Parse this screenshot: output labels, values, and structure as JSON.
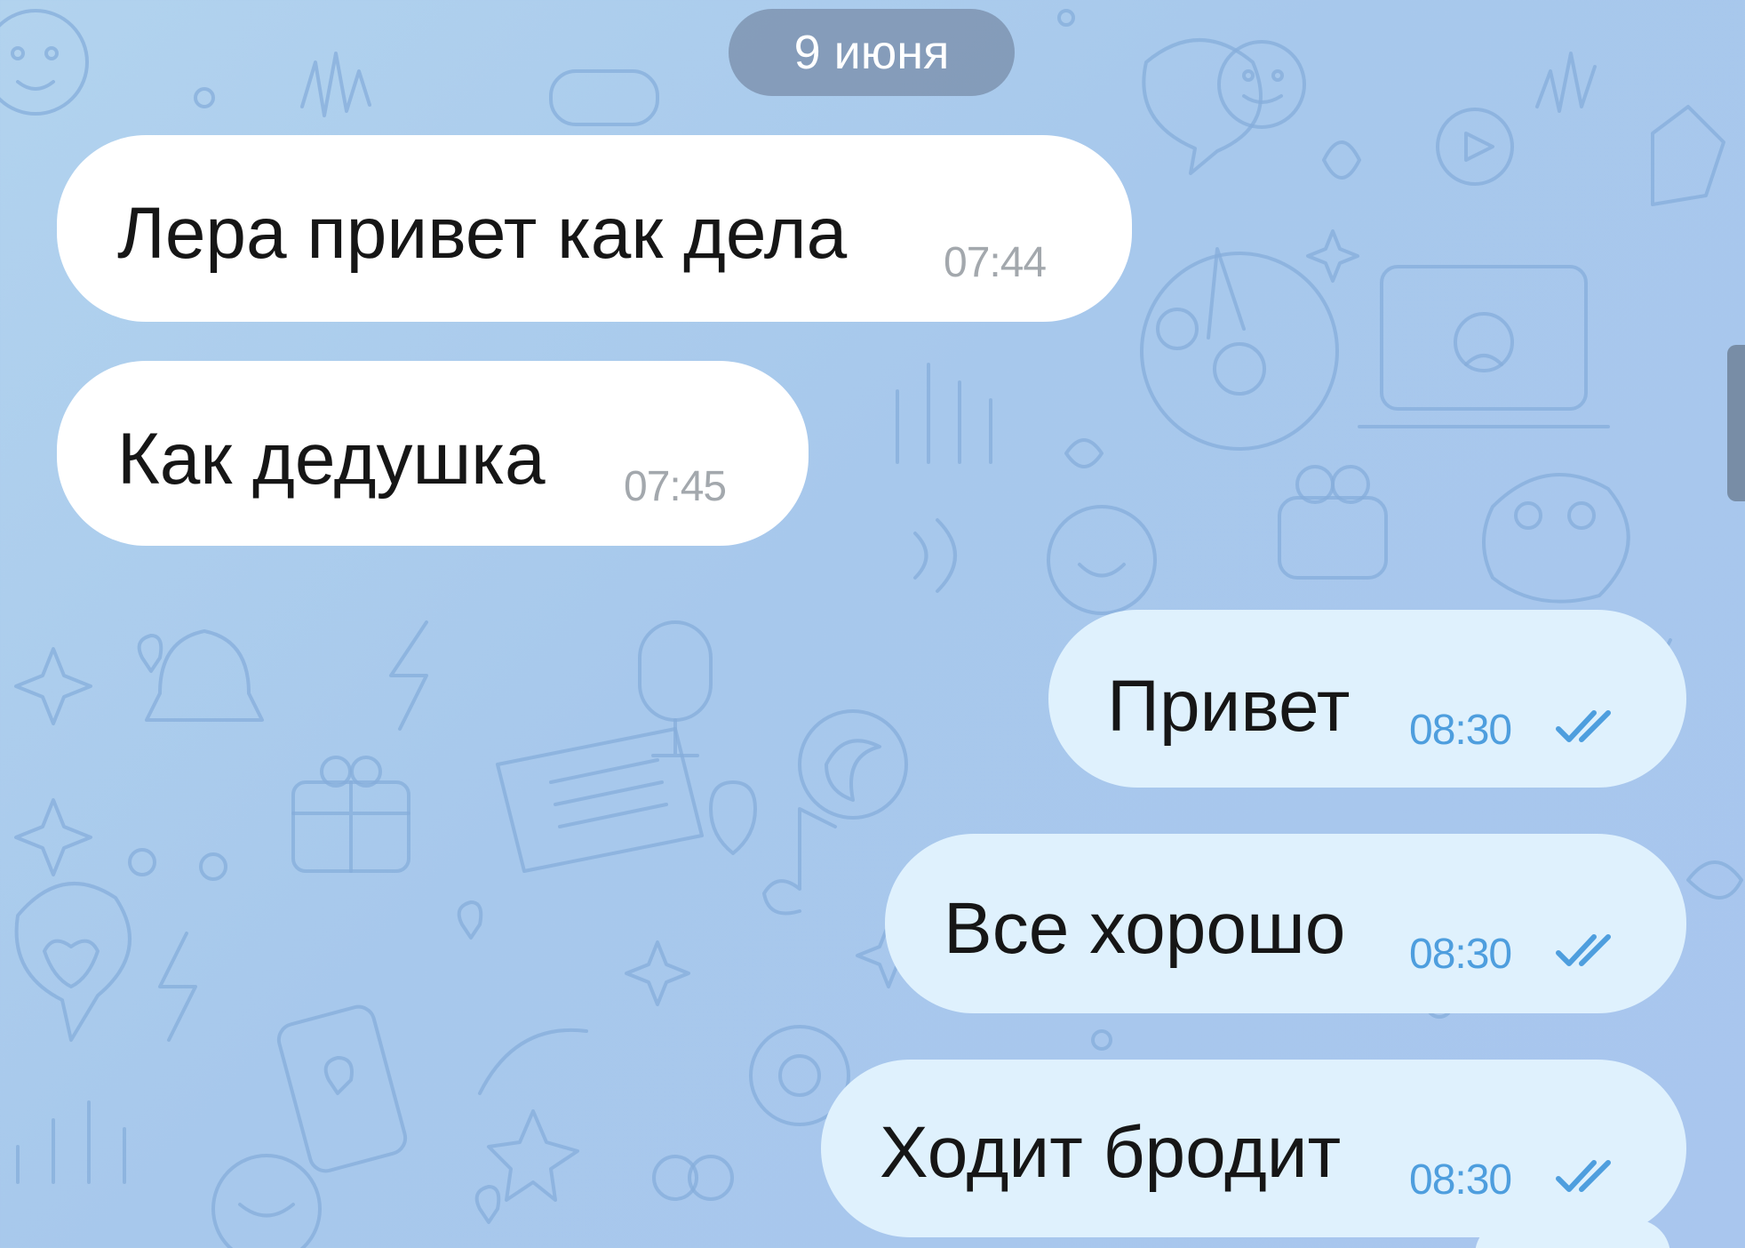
{
  "chat": {
    "date_separator": "9 июня",
    "messages": [
      {
        "direction": "incoming",
        "text": "Лера привет как дела",
        "time": "07:44"
      },
      {
        "direction": "incoming",
        "text": "Как дедушка",
        "time": "07:45"
      },
      {
        "direction": "outgoing",
        "text": "Привет",
        "time": "08:30",
        "status_icon": "double-check-icon"
      },
      {
        "direction": "outgoing",
        "text": "Все хорошо",
        "time": "08:30",
        "status_icon": "double-check-icon"
      },
      {
        "direction": "outgoing",
        "text": "Ходит бродит",
        "time": "08:30",
        "status_icon": "double-check-icon"
      }
    ]
  },
  "colors": {
    "background": "#a9c8ed",
    "incoming_bubble": "#ffffff",
    "outgoing_bubble": "#dff1fd",
    "outgoing_meta": "#4e9ede",
    "incoming_time": "#a3a8ad",
    "date_pill": "#788ca8"
  }
}
